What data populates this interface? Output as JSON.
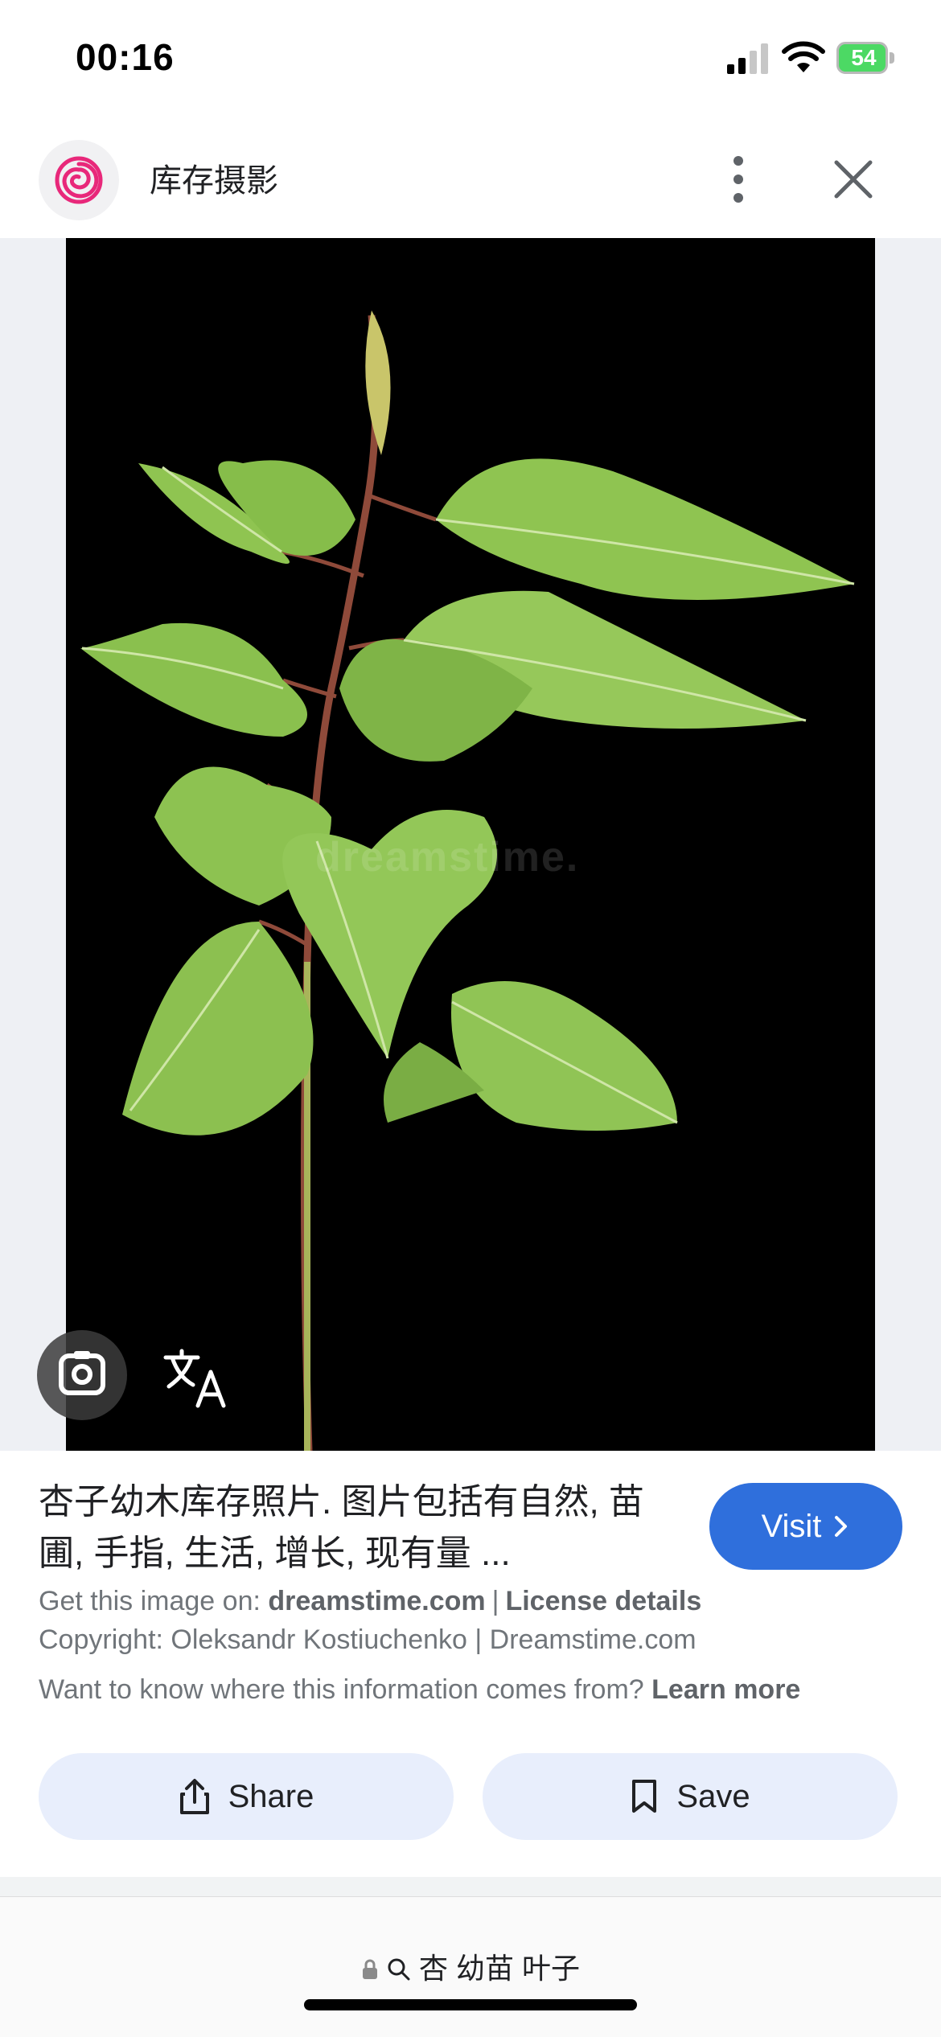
{
  "status_bar": {
    "time": "00:16",
    "battery": "54"
  },
  "header": {
    "site_title": "库存摄影",
    "more_icon": "more-vert-icon",
    "close_icon": "close-icon"
  },
  "image": {
    "watermark": "dreamstime.",
    "overlay_icons": [
      "lens-icon",
      "translate-icon"
    ]
  },
  "result": {
    "title": "杏子幼木库存照片. 图片包括有自然, 苗圃, 手指, 生活, 增长, 现有量 ...",
    "visit_label": "Visit",
    "source_prefix": "Get this image on:",
    "source_domain": "dreamstime.com",
    "license_label": "License details",
    "copyright": "Copyright: Oleksandr Kostiuchenko | Dreamstime.com",
    "info_question": "Want to know where this information comes from?",
    "learn_more": "Learn more",
    "share_label": "Share",
    "save_label": "Save"
  },
  "url_bar": {
    "url": "杏 幼苗 叶子"
  },
  "colors": {
    "accent": "#2f6fdc",
    "button_bg": "#e8eefc",
    "leaf": "#8fc451",
    "battery": "#4cd964"
  }
}
